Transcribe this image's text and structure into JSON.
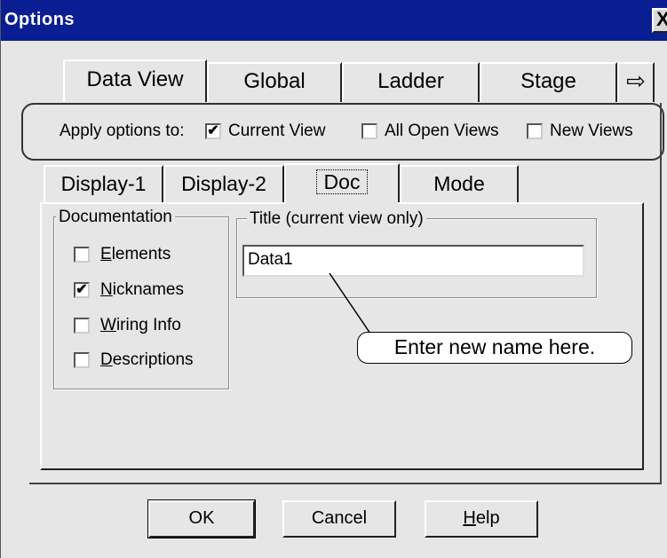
{
  "window": {
    "title": "Options",
    "close_glyph": "X"
  },
  "top_tabs": {
    "items": [
      "Data View",
      "Global",
      "Ladder",
      "Stage"
    ],
    "scroll_glyph": "⇨"
  },
  "apply": {
    "label": "Apply options to:",
    "options": [
      {
        "label": "Current View",
        "checked": true
      },
      {
        "label": "All Open Views",
        "checked": false
      },
      {
        "label": "New Views",
        "checked": false
      }
    ]
  },
  "sub_tabs": {
    "items": [
      "Display-1",
      "Display-2",
      "Doc",
      "Mode"
    ],
    "active": "Doc"
  },
  "documentation": {
    "legend": "Documentation",
    "items": [
      {
        "mnemonic": "E",
        "rest": "lements",
        "checked": false
      },
      {
        "mnemonic": "N",
        "rest": "icknames",
        "checked": true
      },
      {
        "mnemonic": "W",
        "rest": "iring Info",
        "checked": false
      },
      {
        "mnemonic": "D",
        "rest": "escriptions",
        "checked": false
      }
    ]
  },
  "title_group": {
    "legend": "Title (current view only)",
    "value": "Data1"
  },
  "callout": {
    "text": "Enter new name here."
  },
  "buttons": {
    "ok": "OK",
    "cancel": "Cancel",
    "help_mnemonic": "H",
    "help_rest": "elp"
  },
  "colors": {
    "titlebar": "#0a1e94",
    "dialog": "#e6e6e6"
  }
}
